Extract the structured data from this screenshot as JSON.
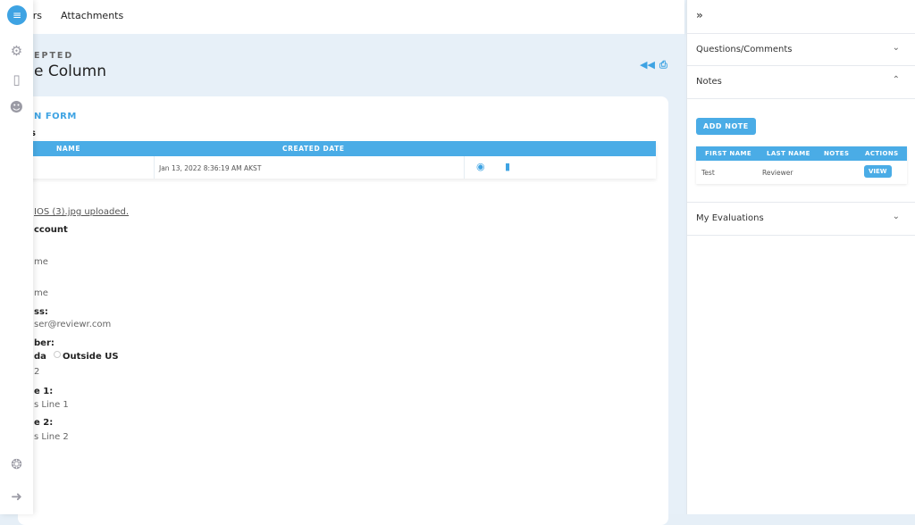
{
  "topbar": {
    "tabs": [
      "ors",
      "Attachments"
    ]
  },
  "header": {
    "status": "EPTED",
    "title": "e Column"
  },
  "form": {
    "title": "N FORM",
    "section": "s",
    "table": {
      "columns": [
        "NAME",
        "CREATED DATE"
      ],
      "rows": [
        {
          "name": "",
          "created": "Jan 13, 2022 8:36:19 AM AKST"
        }
      ]
    },
    "upload_link": "IOS (3).jpg uploaded.",
    "account_heading": "ccount",
    "fields": [
      {
        "label": "",
        "value": "me"
      },
      {
        "label": "",
        "value": "me"
      },
      {
        "label": "ss:",
        "value": "ser@reviewr.com"
      },
      {
        "label": "ber:",
        "value": "2"
      },
      {
        "label": "e 1:",
        "value": "s Line 1"
      },
      {
        "label": "e 2:",
        "value": "s Line 2"
      }
    ],
    "radio": {
      "option1": "da",
      "option2": "Outside US"
    }
  },
  "right": {
    "sections": [
      "Questions/Comments",
      "Notes",
      "My Evaluations"
    ],
    "add_note": "ADD NOTE",
    "notes_table": {
      "columns": [
        "FIRST NAME",
        "LAST NAME",
        "NOTES",
        "ACTIONS"
      ],
      "rows": [
        {
          "first": "Test",
          "last": "Reviewer",
          "notes": "",
          "action": "VIEW"
        }
      ]
    }
  },
  "colors": {
    "accent": "#4aace6"
  }
}
